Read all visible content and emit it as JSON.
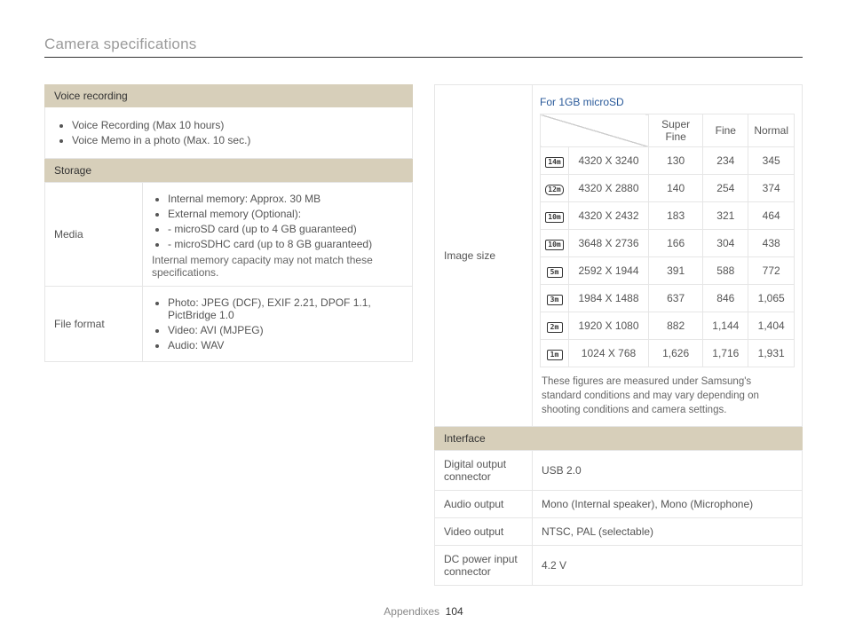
{
  "page": {
    "title": "Camera specifications",
    "footer_section": "Appendixes",
    "footer_page": "104"
  },
  "left": {
    "voice_recording": {
      "header": "Voice recording",
      "items": [
        "Voice Recording (Max 10 hours)",
        "Voice Memo in a photo (Max. 10 sec.)"
      ]
    },
    "storage": {
      "header": "Storage",
      "media": {
        "label": "Media",
        "items": [
          "Internal memory: Approx. 30 MB",
          "External memory (Optional):"
        ],
        "sub": [
          "microSD card (up to 4 GB guaranteed)",
          "microSDHC card (up to 8 GB guaranteed)"
        ],
        "note": "Internal memory capacity may not match these specifications."
      },
      "file_format": {
        "label": "File format",
        "items": [
          "Photo: JPEG (DCF), EXIF 2.21, DPOF 1.1, PictBridge 1.0",
          "Video: AVI (MJPEG)",
          "Audio: WAV"
        ]
      }
    }
  },
  "right": {
    "image_size": {
      "label": "Image size",
      "title": "For 1GB microSD",
      "cols": [
        "Super Fine",
        "Fine",
        "Normal"
      ],
      "rows": [
        {
          "res": "4320 X 3240",
          "vals": [
            "130",
            "234",
            "345"
          ]
        },
        {
          "res": "4320 X 2880",
          "vals": [
            "140",
            "254",
            "374"
          ]
        },
        {
          "res": "4320 X 2432",
          "vals": [
            "183",
            "321",
            "464"
          ]
        },
        {
          "res": "3648 X 2736",
          "vals": [
            "166",
            "304",
            "438"
          ]
        },
        {
          "res": "2592 X 1944",
          "vals": [
            "391",
            "588",
            "772"
          ]
        },
        {
          "res": "1984 X 1488",
          "vals": [
            "637",
            "846",
            "1,065"
          ]
        },
        {
          "res": "1920 X 1080",
          "vals": [
            "882",
            "1,144",
            "1,404"
          ]
        },
        {
          "res": "1024 X 768",
          "vals": [
            "1,626",
            "1,716",
            "1,931"
          ]
        }
      ],
      "icons": [
        "14m",
        "12m",
        "10m",
        "10m",
        "5m",
        "3m",
        "2m",
        "1m"
      ],
      "footnote": "These figures are measured under Samsung's standard conditions and may vary depending on shooting conditions and camera settings."
    },
    "interface": {
      "header": "Interface",
      "rows": [
        {
          "label": "Digital output connector",
          "value": "USB 2.0"
        },
        {
          "label": "Audio output",
          "value": "Mono (Internal speaker), Mono (Microphone)"
        },
        {
          "label": "Video output",
          "value": "NTSC, PAL (selectable)"
        },
        {
          "label": "DC power input connector",
          "value": "4.2 V"
        }
      ]
    }
  }
}
